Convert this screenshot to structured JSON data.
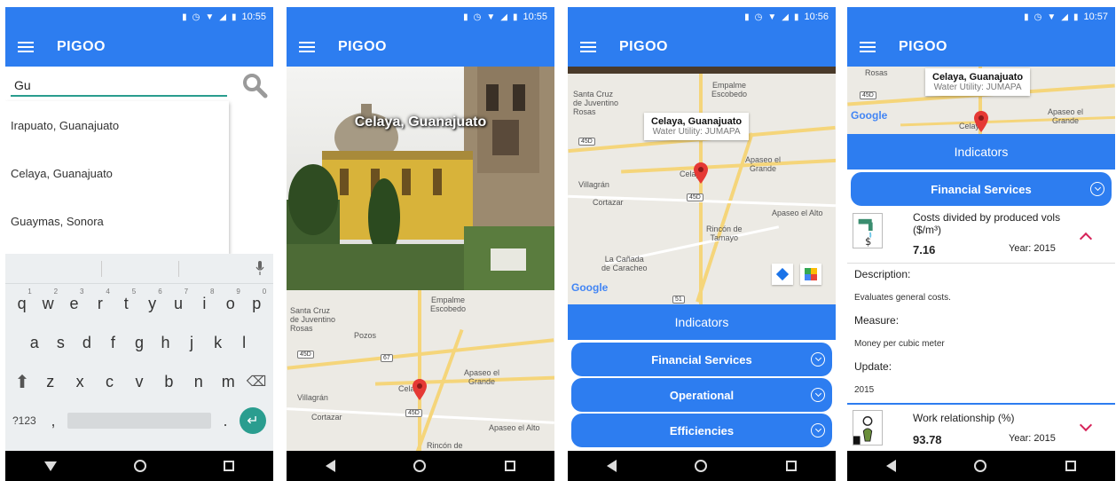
{
  "status": {
    "time1": "10:55",
    "time2": "10:55",
    "time3": "10:56",
    "time4": "10:57"
  },
  "app": {
    "title": "PIGOO"
  },
  "search": {
    "value": "Gu",
    "suggestions": [
      "Irapuato, Guanajuato",
      "Celaya, Guanajuato",
      "Guaymas, Sonora"
    ]
  },
  "keyboard": {
    "row1": [
      "q",
      "w",
      "e",
      "r",
      "t",
      "y",
      "u",
      "i",
      "o",
      "p"
    ],
    "row1_hints": [
      "1",
      "2",
      "3",
      "4",
      "5",
      "6",
      "7",
      "8",
      "9",
      "0"
    ],
    "row2": [
      "a",
      "s",
      "d",
      "f",
      "g",
      "h",
      "j",
      "k",
      "l"
    ],
    "row3": [
      "z",
      "x",
      "c",
      "v",
      "b",
      "n",
      "m"
    ],
    "symbols": "?123",
    "comma": ",",
    "dot": "."
  },
  "city": {
    "caption": "Celaya, Guanajuato",
    "info_title": "Celaya, Guanajuato",
    "info_sub": "Water Utility: JUMAPA"
  },
  "map_labels": {
    "santa_cruz": "Santa Cruz\nde Juventino\nRosas",
    "empalme": "Empalme\nEscobedo",
    "pozos": "Pozos",
    "apaseo_grande": "Apaseo el\nGrande",
    "villagran": "Villagrán",
    "cortazar": "Cortazar",
    "celaya": "Celaya",
    "apaseo_alto": "Apaseo el Alto",
    "rincon": "Rincón de\nTamayo",
    "rincon_short": "Rincón de",
    "canada": "La Cañada\nde Caracheo",
    "rosas": "Rosas",
    "google": "Google",
    "hwy_45d": "45D",
    "hwy_67": "67",
    "hwy_51": "51"
  },
  "indicators": {
    "header": "Indicators",
    "categories": [
      "Financial Services",
      "Operational",
      "Efficiencies"
    ],
    "items": [
      {
        "title": "Costs divided by produced vols ($/m³)",
        "value": "7.16",
        "year": "Year: 2015",
        "description_label": "Description:",
        "description": "Evaluates general costs.",
        "measure_label": "Measure:",
        "measure": "Money per cubic meter",
        "update_label": "Update:",
        "update": "2015"
      },
      {
        "title": "Work relationship (%)",
        "value": "93.78",
        "year": "Year: 2015"
      }
    ]
  },
  "colors": {
    "primary": "#2d7df0",
    "accent": "#d6245a",
    "teal": "#2a9d8f"
  }
}
